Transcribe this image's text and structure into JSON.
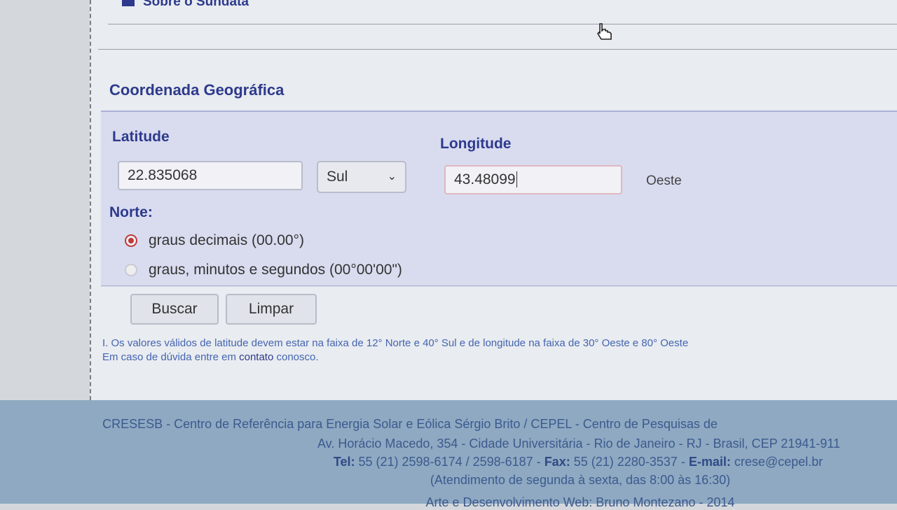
{
  "header": {
    "sobre_label": "Sobre o Sundata"
  },
  "section": {
    "title": "Coordenada Geográfica"
  },
  "form": {
    "latitude": {
      "label": "Latitude",
      "value": "22.835068",
      "hemisphere_selected": "Sul"
    },
    "longitude": {
      "label": "Longitude",
      "value": "43.48099",
      "hemisphere_text": "Oeste"
    },
    "norte_label": "Norte:",
    "format_options": [
      {
        "label": "graus decimais (00.00°)",
        "selected": true
      },
      {
        "label": "graus, minutos e segundos (00°00'00\")",
        "selected": false
      }
    ],
    "buttons": {
      "search": "Buscar",
      "clear": "Limpar"
    }
  },
  "notes": {
    "line1": "I. Os valores válidos de latitude devem estar na faixa de 12° Norte e 40° Sul e de longitude na faixa de 30° Oeste e 80° Oeste",
    "line2_prefix": "Em caso de dúvida entre em ",
    "line2_link": "contato",
    "line2_suffix": " conosco."
  },
  "footer": {
    "line1": "CRESESB - Centro de Referência para Energia Solar e Eólica Sérgio Brito / CEPEL - Centro de Pesquisas de",
    "line2": "Av. Horácio Macedo, 354 - Cidade Universitária - Rio de Janeiro - RJ - Brasil, CEP 21941-911",
    "tel_label": "Tel:",
    "tel_value": " 55 (21) 2598-6174 / 2598-6187 - ",
    "fax_label": "Fax:",
    "fax_value": " 55 (21) 2280-3537 - ",
    "email_label": "E-mail:",
    "email_value": " crese@cepel.br",
    "line4": "(Atendimento de segunda à sexta, das 8:00 às 16:30)",
    "line5": "Arte e Desenvolvimento Web: Bruno Montezano - 2014"
  }
}
